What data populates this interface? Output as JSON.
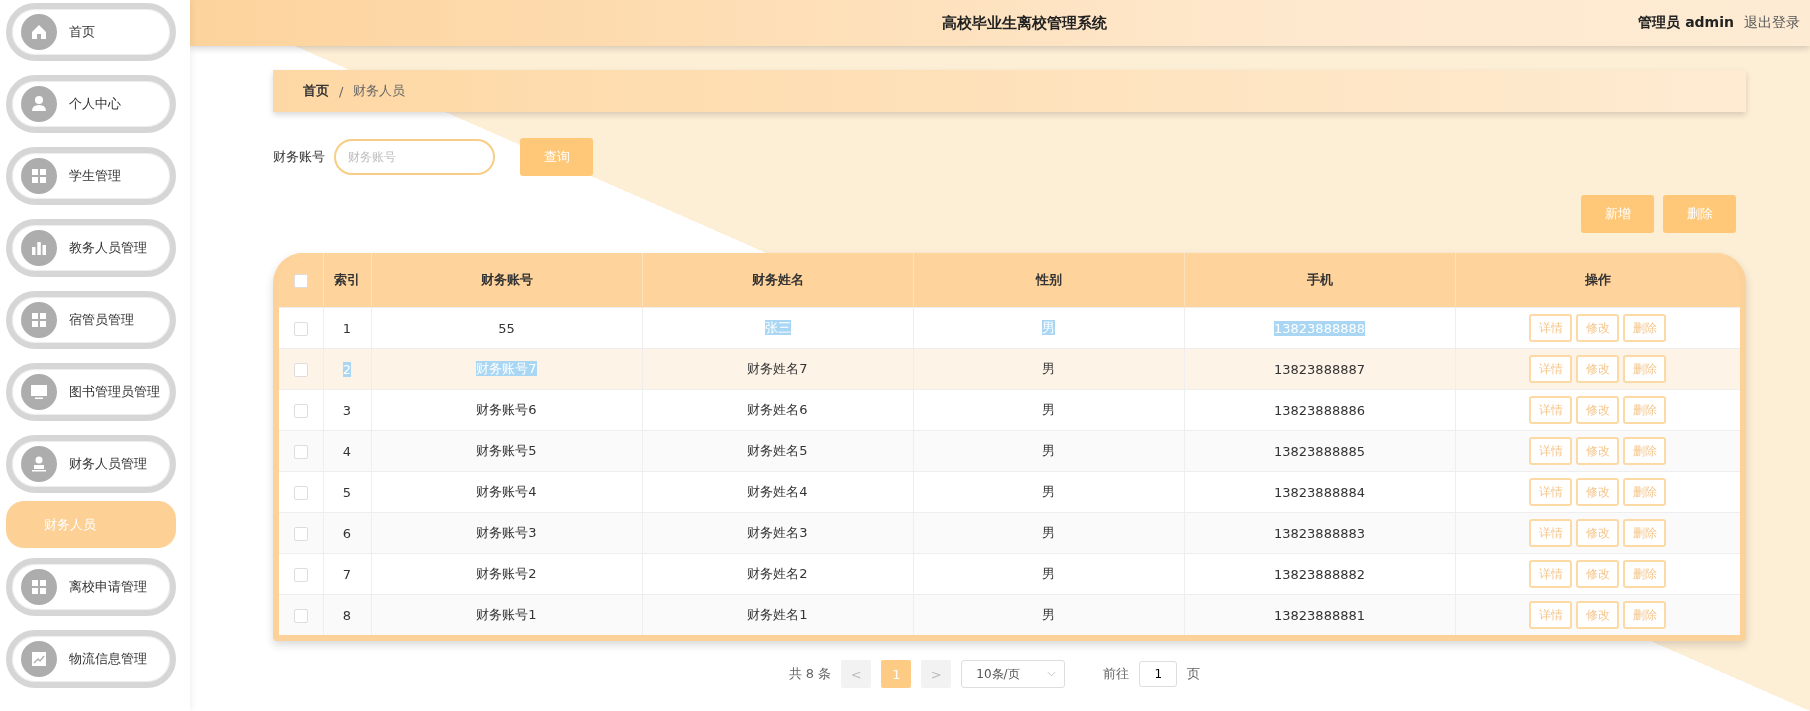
{
  "header": {
    "title": "高校毕业生离校管理系统",
    "user": "管理员 admin",
    "logout": "退出登录"
  },
  "sidebar": {
    "items": [
      {
        "label": "首页",
        "selected": false
      },
      {
        "label": "个人中心",
        "selected": false
      },
      {
        "label": "学生管理",
        "selected": false
      },
      {
        "label": "教务人员管理",
        "selected": false
      },
      {
        "label": "宿管员管理",
        "selected": false
      },
      {
        "label": "图书管理员管理",
        "selected": false
      },
      {
        "label": "财务人员管理",
        "selected": false,
        "children": [
          {
            "label": "财务人员",
            "selected": true
          }
        ]
      },
      {
        "label": "离校申请管理",
        "selected": false
      },
      {
        "label": "物流信息管理",
        "selected": false
      }
    ]
  },
  "breadcrumb": [
    "首页",
    "/",
    "财务人员"
  ],
  "search": {
    "label": "财务账号",
    "placeholder": "财务账号",
    "button": "查询"
  },
  "actions": [
    "新增",
    "删除"
  ],
  "table": {
    "columns": [
      "索引",
      "财务账号",
      "财务姓名",
      "性别",
      "手机",
      "操作"
    ],
    "all_checked": false,
    "rows": [
      {
        "checked": false,
        "hovered": false,
        "cells": [
          {
            "text": "1",
            "highlighted": false
          },
          {
            "text": "55",
            "highlighted": false
          },
          {
            "text": "张三",
            "highlighted": true
          },
          {
            "text": "男",
            "highlighted": true
          },
          {
            "text": "13823888888",
            "highlighted": true
          }
        ],
        "actions": [
          "详情",
          "修改",
          "删除"
        ]
      },
      {
        "checked": false,
        "hovered": true,
        "cells": [
          {
            "text": "2",
            "highlighted": true
          },
          {
            "text": "财务账号7",
            "highlighted": true
          },
          {
            "text": "财务姓名7",
            "highlighted": false
          },
          {
            "text": "男",
            "highlighted": false
          },
          {
            "text": "13823888887",
            "highlighted": false
          }
        ],
        "actions": [
          "详情",
          "修改",
          "删除"
        ]
      },
      {
        "checked": false,
        "hovered": false,
        "cells": [
          {
            "text": "3",
            "highlighted": false
          },
          {
            "text": "财务账号6",
            "highlighted": false
          },
          {
            "text": "财务姓名6",
            "highlighted": false
          },
          {
            "text": "男",
            "highlighted": false
          },
          {
            "text": "13823888886",
            "highlighted": false
          }
        ],
        "actions": [
          "详情",
          "修改",
          "删除"
        ]
      },
      {
        "checked": false,
        "hovered": false,
        "cells": [
          {
            "text": "4",
            "highlighted": false
          },
          {
            "text": "财务账号5",
            "highlighted": false
          },
          {
            "text": "财务姓名5",
            "highlighted": false
          },
          {
            "text": "男",
            "highlighted": false
          },
          {
            "text": "13823888885",
            "highlighted": false
          }
        ],
        "actions": [
          "详情",
          "修改",
          "删除"
        ]
      },
      {
        "checked": false,
        "hovered": false,
        "cells": [
          {
            "text": "5",
            "highlighted": false
          },
          {
            "text": "财务账号4",
            "highlighted": false
          },
          {
            "text": "财务姓名4",
            "highlighted": false
          },
          {
            "text": "男",
            "highlighted": false
          },
          {
            "text": "13823888884",
            "highlighted": false
          }
        ],
        "actions": [
          "详情",
          "修改",
          "删除"
        ]
      },
      {
        "checked": false,
        "hovered": false,
        "cells": [
          {
            "text": "6",
            "highlighted": false
          },
          {
            "text": "财务账号3",
            "highlighted": false
          },
          {
            "text": "财务姓名3",
            "highlighted": false
          },
          {
            "text": "男",
            "highlighted": false
          },
          {
            "text": "13823888883",
            "highlighted": false
          }
        ],
        "actions": [
          "详情",
          "修改",
          "删除"
        ]
      },
      {
        "checked": false,
        "hovered": false,
        "cells": [
          {
            "text": "7",
            "highlighted": false
          },
          {
            "text": "财务账号2",
            "highlighted": false
          },
          {
            "text": "财务姓名2",
            "highlighted": false
          },
          {
            "text": "男",
            "highlighted": false
          },
          {
            "text": "13823888882",
            "highlighted": false
          }
        ],
        "actions": [
          "详情",
          "修改",
          "删除"
        ]
      },
      {
        "checked": false,
        "hovered": false,
        "cells": [
          {
            "text": "8",
            "highlighted": false
          },
          {
            "text": "财务账号1",
            "highlighted": false
          },
          {
            "text": "财务姓名1",
            "highlighted": false
          },
          {
            "text": "男",
            "highlighted": false
          },
          {
            "text": "13823888881",
            "highlighted": false
          }
        ],
        "actions": [
          "详情",
          "修改",
          "删除"
        ]
      }
    ]
  },
  "pagination": {
    "total": "共 8 条",
    "prev": "<",
    "pages": [
      {
        "label": "1",
        "selected": true
      }
    ],
    "next": ">",
    "page_size": "10条/页",
    "goto_label": "前往",
    "goto_value": "1",
    "goto_unit": "页"
  }
}
